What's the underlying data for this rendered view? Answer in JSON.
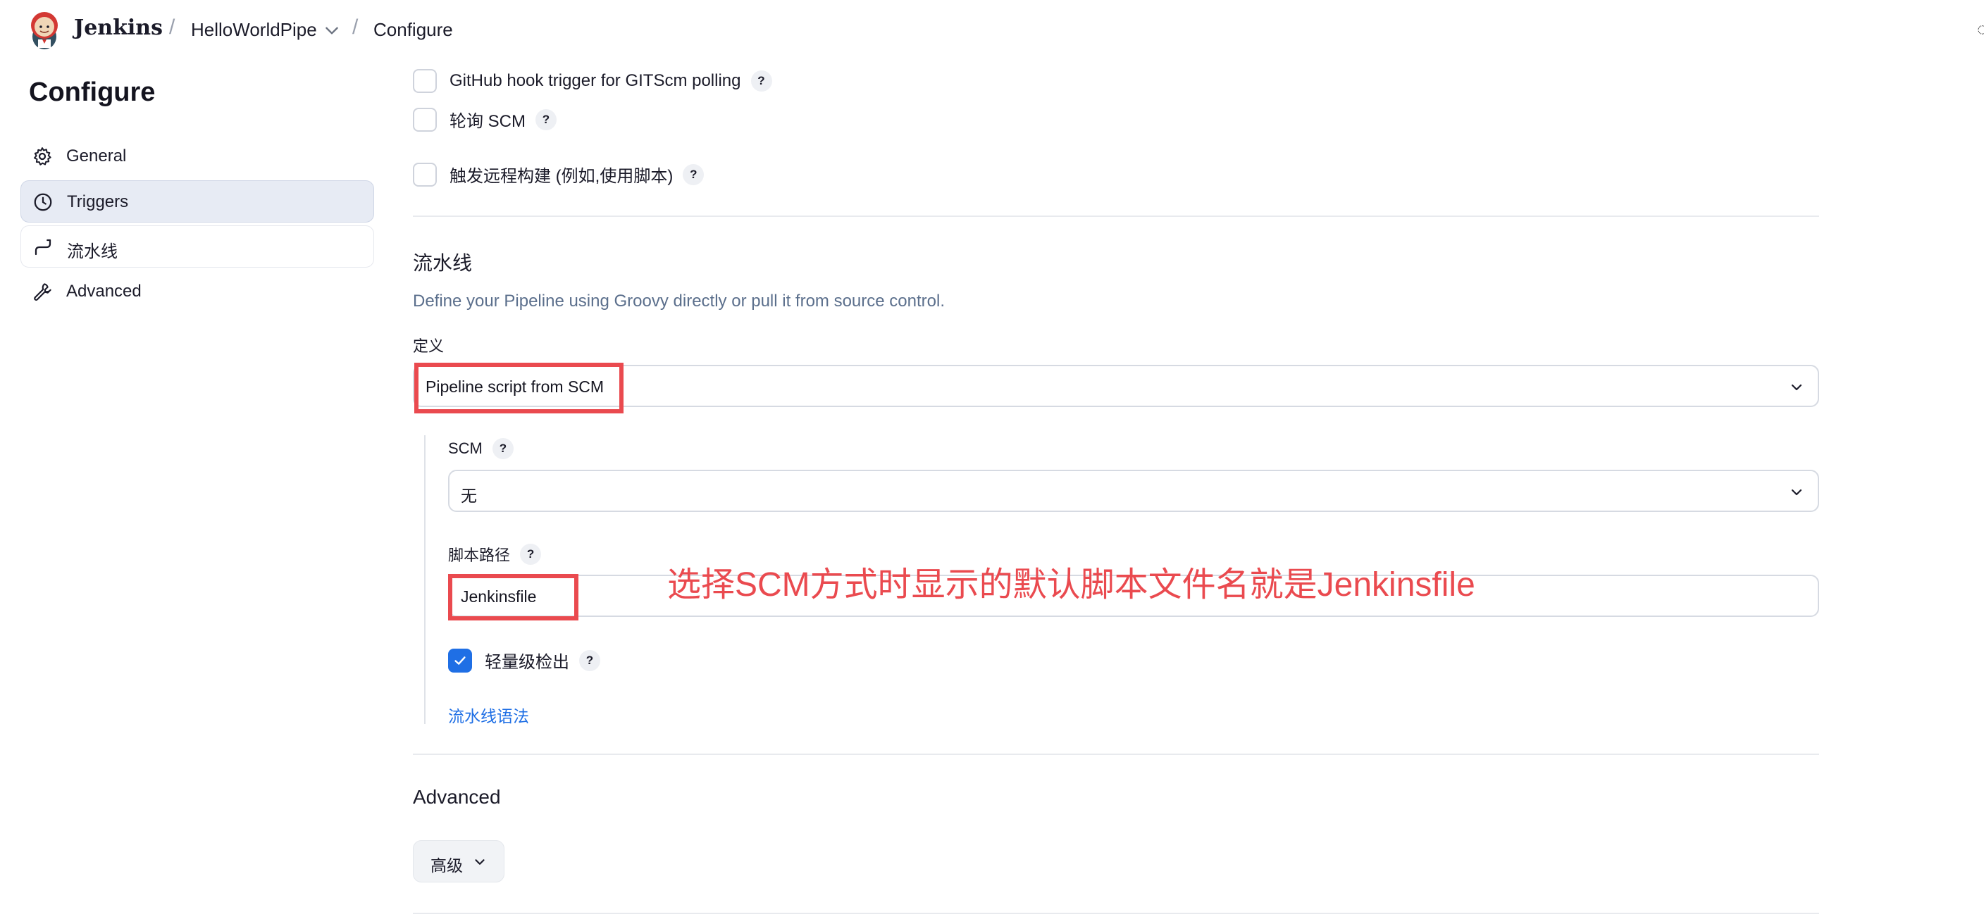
{
  "header": {
    "brand": "Jenkins",
    "separator": "/",
    "job_name": "HelloWorldPipe",
    "current_page": "Configure"
  },
  "sidebar": {
    "title": "Configure",
    "items": [
      {
        "label": "General",
        "icon": "gear-icon"
      },
      {
        "label": "Triggers",
        "icon": "timer-icon"
      },
      {
        "label": "流水线",
        "icon": "pipeline-icon"
      },
      {
        "label": "Advanced",
        "icon": "wrench-icon"
      }
    ],
    "active_item": "Triggers"
  },
  "triggers": {
    "options": [
      {
        "label": "GitHub hook trigger for GITScm polling",
        "checked": false
      },
      {
        "label": "轮询 SCM",
        "checked": false
      },
      {
        "label": "触发远程构建 (例如,使用脚本)",
        "checked": false
      }
    ]
  },
  "pipeline": {
    "title": "流水线",
    "description": "Define your Pipeline using Groovy directly or pull it from source control.",
    "definition_label": "定义",
    "definition_value": "Pipeline script from SCM",
    "scm_label": "SCM",
    "scm_value": "无",
    "script_path_label": "脚本路径",
    "script_path_value": "Jenkinsfile",
    "lightweight_label": "轻量级检出",
    "lightweight_checked": true,
    "syntax_link": "流水线语法"
  },
  "advanced": {
    "title": "Advanced",
    "button_label": "高级"
  },
  "help_glyph": "?",
  "annotation": {
    "text": "选择SCM方式时显示的默认脚本文件名就是Jenkinsfile",
    "color": "#ea4a4f"
  },
  "colors": {
    "accent": "#1f6fe5",
    "annotation_red": "#ea4a4f",
    "active_nav_bg": "#e7ebf4"
  }
}
